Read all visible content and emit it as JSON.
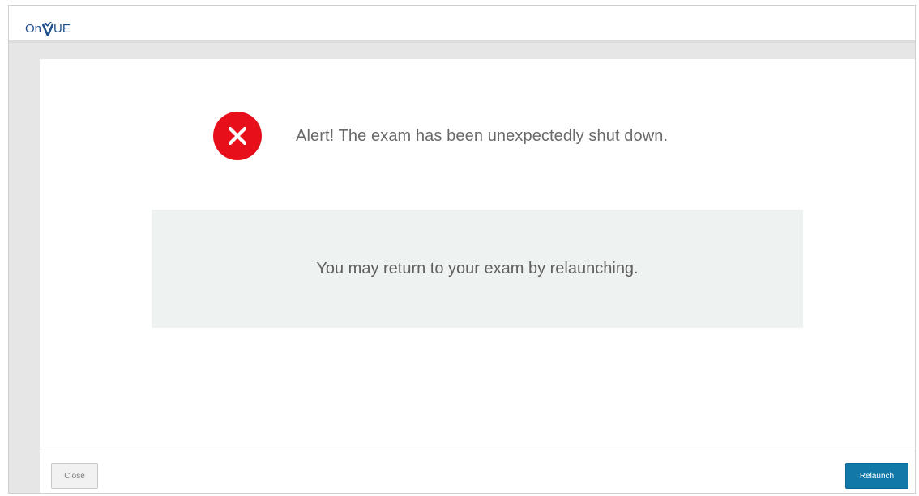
{
  "app": {
    "logo_prefix": "On",
    "logo_suffix": "UE",
    "brand_color": "#1f4f8b"
  },
  "alert": {
    "icon": "error-x-icon",
    "icon_color": "#e60f1a",
    "title": "Alert! The exam has been unexpectedly shut down."
  },
  "message": {
    "text": "You may return to your exam by relaunching."
  },
  "footer": {
    "close_label": "Close",
    "relaunch_label": "Relaunch",
    "relaunch_color": "#1278a8"
  }
}
